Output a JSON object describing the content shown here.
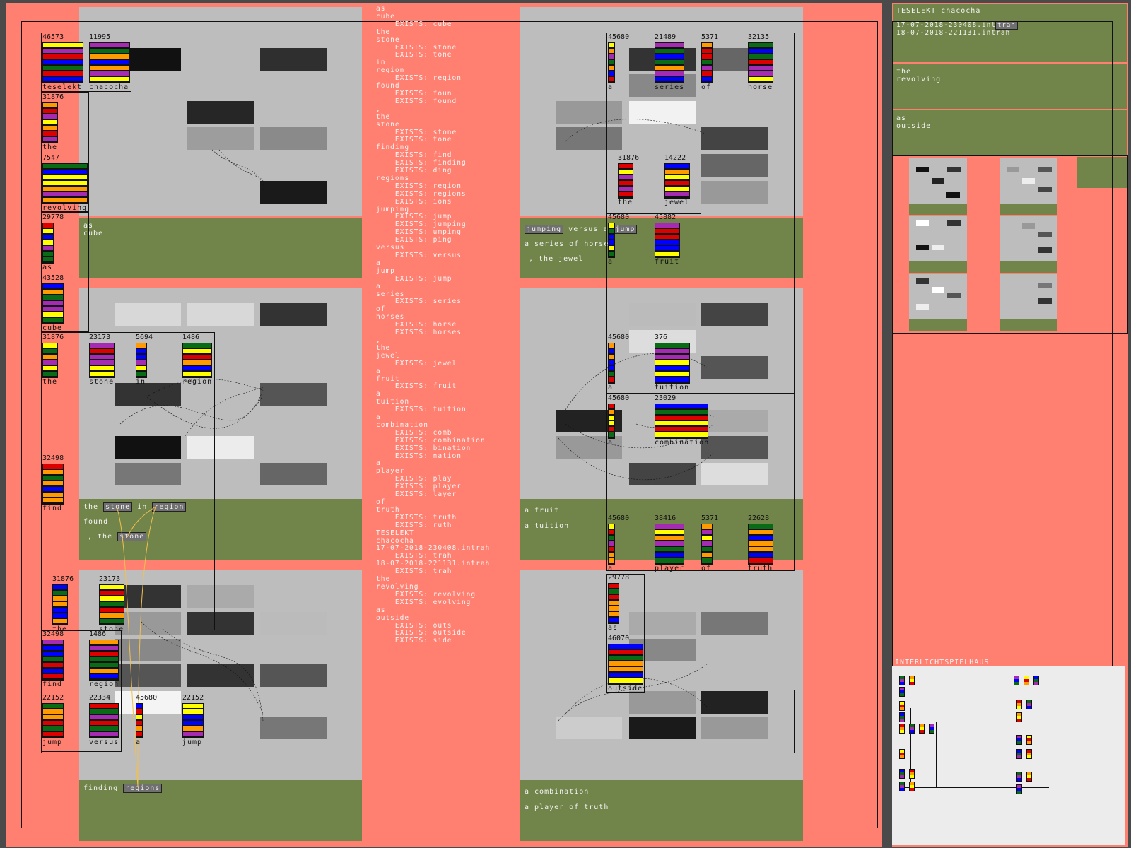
{
  "main_pane": {
    "block1": {
      "caption_lines": [
        "as",
        "cube"
      ]
    },
    "block2": {
      "captions": [
        [
          "the",
          "stone",
          "in",
          "region"
        ],
        [
          "found"
        ],
        [
          ", the",
          "stone"
        ]
      ]
    },
    "block3": {
      "caption": [
        "finding",
        "regions"
      ]
    },
    "block4": {
      "caption_lines": [
        "jumping versus a jump",
        "a series of horse",
        ", the jewel"
      ]
    },
    "block5": {
      "caption_lines": [
        "a fruit",
        "a tuition"
      ]
    },
    "block6": {
      "caption_lines": [
        "a combination",
        "a player of truth"
      ]
    }
  },
  "tags": {
    "stone": "stone",
    "region": "region",
    "stone2": "stone",
    "regions": "regions",
    "jumping": "jumping",
    "jump": "jump"
  },
  "word_stacks_left": [
    {
      "count": "46573",
      "word": "teselekt"
    },
    {
      "count": "11995",
      "word": "chacocha"
    },
    {
      "count": "31876",
      "word": "the"
    },
    {
      "count": "7547",
      "word": "revolving"
    },
    {
      "count": "29778",
      "word": "as"
    },
    {
      "count": "43528",
      "word": "cube"
    },
    {
      "count": "31876",
      "word": "the"
    },
    {
      "count": "23173",
      "word": "stone"
    },
    {
      "count": "5694",
      "word": "in"
    },
    {
      "count": "1486",
      "word": "region"
    },
    {
      "count": "32498",
      "word": "find"
    },
    {
      "count": "31876",
      "word": "the"
    },
    {
      "count": "23173",
      "word": "stone"
    },
    {
      "count": "32498",
      "word": "find"
    },
    {
      "count": "1486",
      "word": "region"
    },
    {
      "count": "22152",
      "word": "jump"
    },
    {
      "count": "22334",
      "word": "versus"
    },
    {
      "count": "45680",
      "word": "a"
    },
    {
      "count": "22152",
      "word": "jump"
    }
  ],
  "word_stacks_right": [
    {
      "count": "45680",
      "word": "a"
    },
    {
      "count": "21489",
      "word": "series"
    },
    {
      "count": "5371",
      "word": "of"
    },
    {
      "count": "32135",
      "word": "horse"
    },
    {
      "count": "31876",
      "word": "the"
    },
    {
      "count": "14222",
      "word": "jewel"
    },
    {
      "count": "45680",
      "word": "a"
    },
    {
      "count": "45882",
      "word": "fruit"
    },
    {
      "count": "45680",
      "word": "a"
    },
    {
      "count": "376",
      "word": "tuition"
    },
    {
      "count": "45680",
      "word": "a"
    },
    {
      "count": "23029",
      "word": "combination"
    },
    {
      "count": "45680",
      "word": "a"
    },
    {
      "count": "38416",
      "word": "player"
    },
    {
      "count": "5371",
      "word": "of"
    },
    {
      "count": "22628",
      "word": "truth"
    },
    {
      "count": "29778",
      "word": "as"
    },
    {
      "count": "46070",
      "word": "outside"
    }
  ],
  "middle_text": "as\ncube\n    EXISTS: cube\nthe\nstone\n    EXISTS: stone\n    EXISTS: tone\nin\nregion\n    EXISTS: region\nfound\n    EXISTS: foun\n    EXISTS: found\n,\nthe\nstone\n    EXISTS: stone\n    EXISTS: tone\nfinding\n    EXISTS: find\n    EXISTS: finding\n    EXISTS: ding\nregions\n    EXISTS: region\n    EXISTS: regions\n    EXISTS: ions\njumping\n    EXISTS: jump\n    EXISTS: jumping\n    EXISTS: umping\n    EXISTS: ping\nversus\n    EXISTS: versus\na\njump\n    EXISTS: jump\na\nseries\n    EXISTS: series\nof\nhorses\n    EXISTS: horse\n    EXISTS: horses\n,\nthe\njewel\n    EXISTS: jewel\na\nfruit\n    EXISTS: fruit\na\ntuition\n    EXISTS: tuition\na\ncombination\n    EXISTS: comb\n    EXISTS: combination\n    EXISTS: bination\n    EXISTS: nation\na\nplayer\n    EXISTS: play\n    EXISTS: player\n    EXISTS: layer\nof\ntruth\n    EXISTS: truth\n    EXISTS: ruth\nTESELEKT\nchacocha\n17-07-2018-230408.intrah\n    EXISTS: trah\n18-07-2018-221131.intrah\n    EXISTS: trah\nthe\nrevolving\n    EXISTS: revolving\n    EXISTS: evolving\nas\noutside\n    EXISTS: outs\n    EXISTS: outside\n    EXISTS: side",
  "sidebar": {
    "title": "TESELEKT chacocha",
    "files": [
      "17-07-2018-230408.intrah",
      "18-07-2018-221131.intrah"
    ],
    "file_tag": "trah",
    "block2": [
      "the",
      "revolving"
    ],
    "block3": [
      "as",
      "outside"
    ],
    "legend_title": "INTERLICHTSPIELHAUS"
  },
  "colors": {
    "salmon": "#ff8070",
    "panel_gray": "#bdbdbd",
    "olive": "#718449",
    "bg": "#4a4a4a"
  }
}
